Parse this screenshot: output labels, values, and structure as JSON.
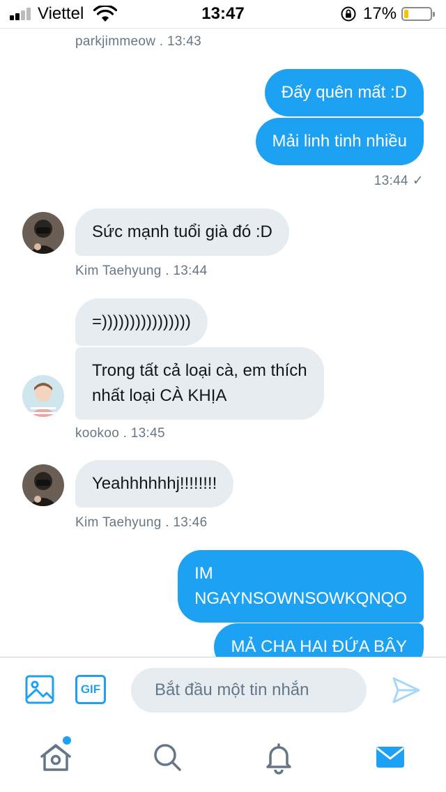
{
  "status_bar": {
    "carrier": "Viettel",
    "time": "13:47",
    "battery_percent": "17%",
    "battery_level": 0.17,
    "icons": [
      "signal-icon",
      "wifi-icon",
      "rotation-lock-icon",
      "battery-icon"
    ]
  },
  "messages": [
    {
      "kind": "meta",
      "text": "parkjimmeow . 13:43"
    },
    {
      "kind": "outgoing",
      "text": "Đấy quên mất :D"
    },
    {
      "kind": "outgoing",
      "text": "Mải linh tinh nhiều"
    },
    {
      "kind": "meta",
      "text": "13:44",
      "status": "✓"
    },
    {
      "kind": "incoming",
      "sender": "Kim Taehyung",
      "text": "Sức mạnh tuổi già đó :D"
    },
    {
      "kind": "meta",
      "text": "Kim Taehyung . 13:44"
    },
    {
      "kind": "incoming",
      "sender": "kookoo",
      "text": "=))))))))))))))))"
    },
    {
      "kind": "incoming",
      "sender": "kookoo",
      "lines": [
        "Trong tất cả loại cà, em thích",
        "nhất loại CÀ KHỊA"
      ]
    },
    {
      "kind": "meta",
      "text": "kookoo . 13:45"
    },
    {
      "kind": "incoming",
      "sender": "Kim Taehyung",
      "text": "Yeahhhhhhj!!!!!!!!"
    },
    {
      "kind": "meta",
      "text": "Kim Taehyung . 13:46"
    },
    {
      "kind": "outgoing",
      "lines": [
        "IM",
        "NGAYNSOWNSOWKQNQO"
      ]
    },
    {
      "kind": "outgoing",
      "text": "MẢ CHA HAI ĐỨA BÂY"
    }
  ],
  "composer": {
    "placeholder": "Bắt đầu một tin nhắn",
    "gif_label": "GIF",
    "icons": [
      "image-icon",
      "gif-icon",
      "send-icon"
    ]
  },
  "tabbar": {
    "icons": [
      "home-icon",
      "search-icon",
      "notifications-icon",
      "messages-icon"
    ],
    "active": "messages",
    "home_has_notification": true
  },
  "colors": {
    "accent": "#1da1f2",
    "incoming_bubble": "#e6ecf0",
    "meta_text": "#657786",
    "battery": "#f5c400"
  }
}
